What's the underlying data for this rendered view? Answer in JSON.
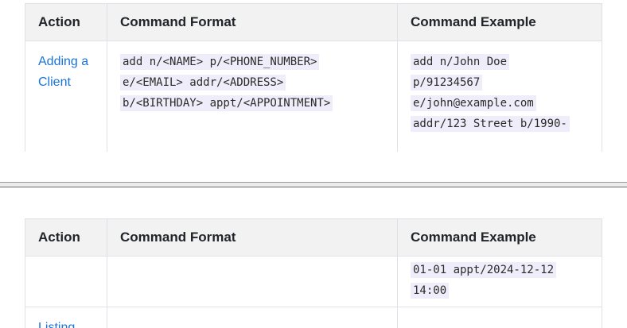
{
  "table": {
    "headers": {
      "action": "Action",
      "format": "Command Format",
      "example": "Command Example"
    }
  },
  "rows": {
    "add": {
      "action": "Adding a Client",
      "format_lines": [
        "add n/<NAME> p/<PHONE_NUMBER>",
        "e/<EMAIL> addr/<ADDRESS>",
        "b/<BIRTHDAY> appt/<APPOINTMENT>"
      ],
      "example_lines_top": [
        "add n/John Doe",
        "p/91234567",
        "e/john@example.com",
        "addr/123 Street b/1990-"
      ],
      "example_lines_bottom": [
        "01-01 appt/2024-12-12",
        "14:00"
      ]
    },
    "list": {
      "action": "Listing"
    }
  }
}
